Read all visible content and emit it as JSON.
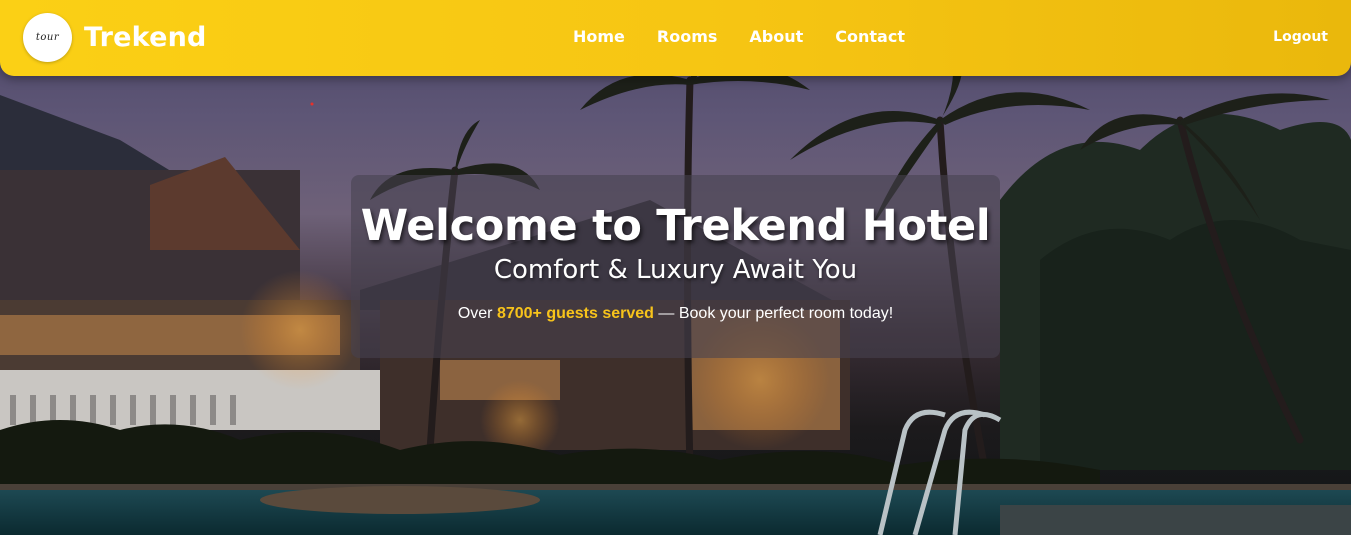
{
  "brand": {
    "logo_text": "tour",
    "name": "Trekend"
  },
  "nav": {
    "links": [
      {
        "label": "Home"
      },
      {
        "label": "Rooms"
      },
      {
        "label": "About"
      },
      {
        "label": "Contact"
      }
    ],
    "logout_label": "Logout"
  },
  "hero": {
    "title": "Welcome to Trekend Hotel",
    "subtitle": "Comfort & Luxury Await You",
    "tagline_prefix": "Over ",
    "tagline_highlight": "8700+ guests served",
    "tagline_suffix": " — Book your perfect room today!"
  },
  "colors": {
    "navbar": "#f6c513",
    "highlight": "#f7c31b",
    "text": "#ffffff"
  }
}
